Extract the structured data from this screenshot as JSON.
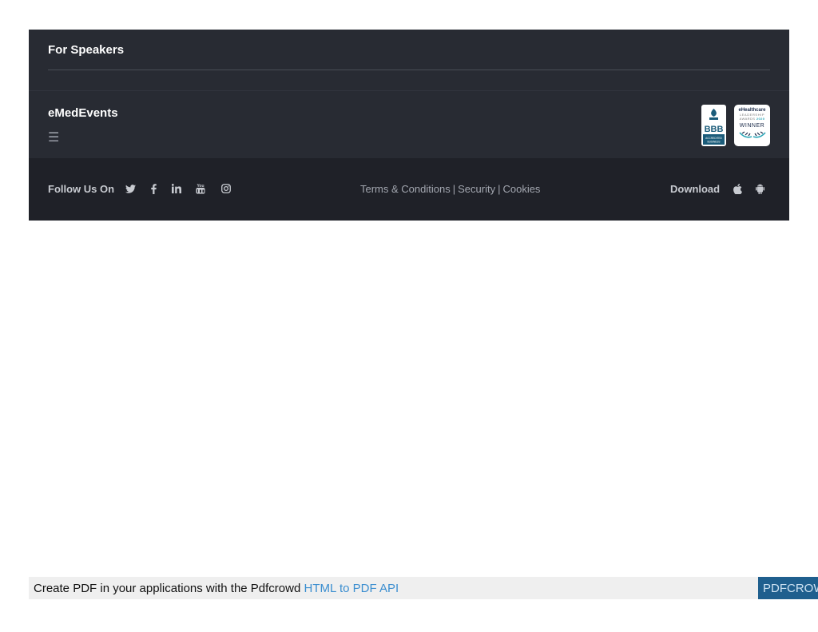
{
  "speakers": {
    "title": "For Speakers"
  },
  "brand": {
    "name": "eMedEvents",
    "menu_glyph": "☰"
  },
  "badges": {
    "bbb": {
      "name": "BBB",
      "line1": "ACCREDITED",
      "line2": "BUSINESS"
    },
    "award": {
      "line1": "eHealthcare",
      "line2": "LEADERSHIP",
      "line3_a": "AWARDS",
      "line3_b": "2020",
      "line4": "WINNER"
    }
  },
  "bottom": {
    "follow_label": "Follow Us On",
    "social_icons": [
      "twitter-icon",
      "facebook-icon",
      "linkedin-icon",
      "youtube-icon",
      "instagram-icon"
    ],
    "links": {
      "terms": "Terms & Conditions",
      "security": "Security",
      "cookies": "Cookies",
      "separator": "|"
    },
    "download_label": "Download",
    "download_icons": [
      "apple-icon",
      "android-icon"
    ]
  },
  "pdfcrowd": {
    "text": "Create PDF in your applications with the Pdfcrowd",
    "link": "HTML to PDF API",
    "brand": "PDFCROWD"
  },
  "colors": {
    "footer_bg": "#282b33",
    "bottom_bg": "#1f2128",
    "link_blue": "#3b8ed0",
    "brand_blue": "#1f5f8e"
  }
}
